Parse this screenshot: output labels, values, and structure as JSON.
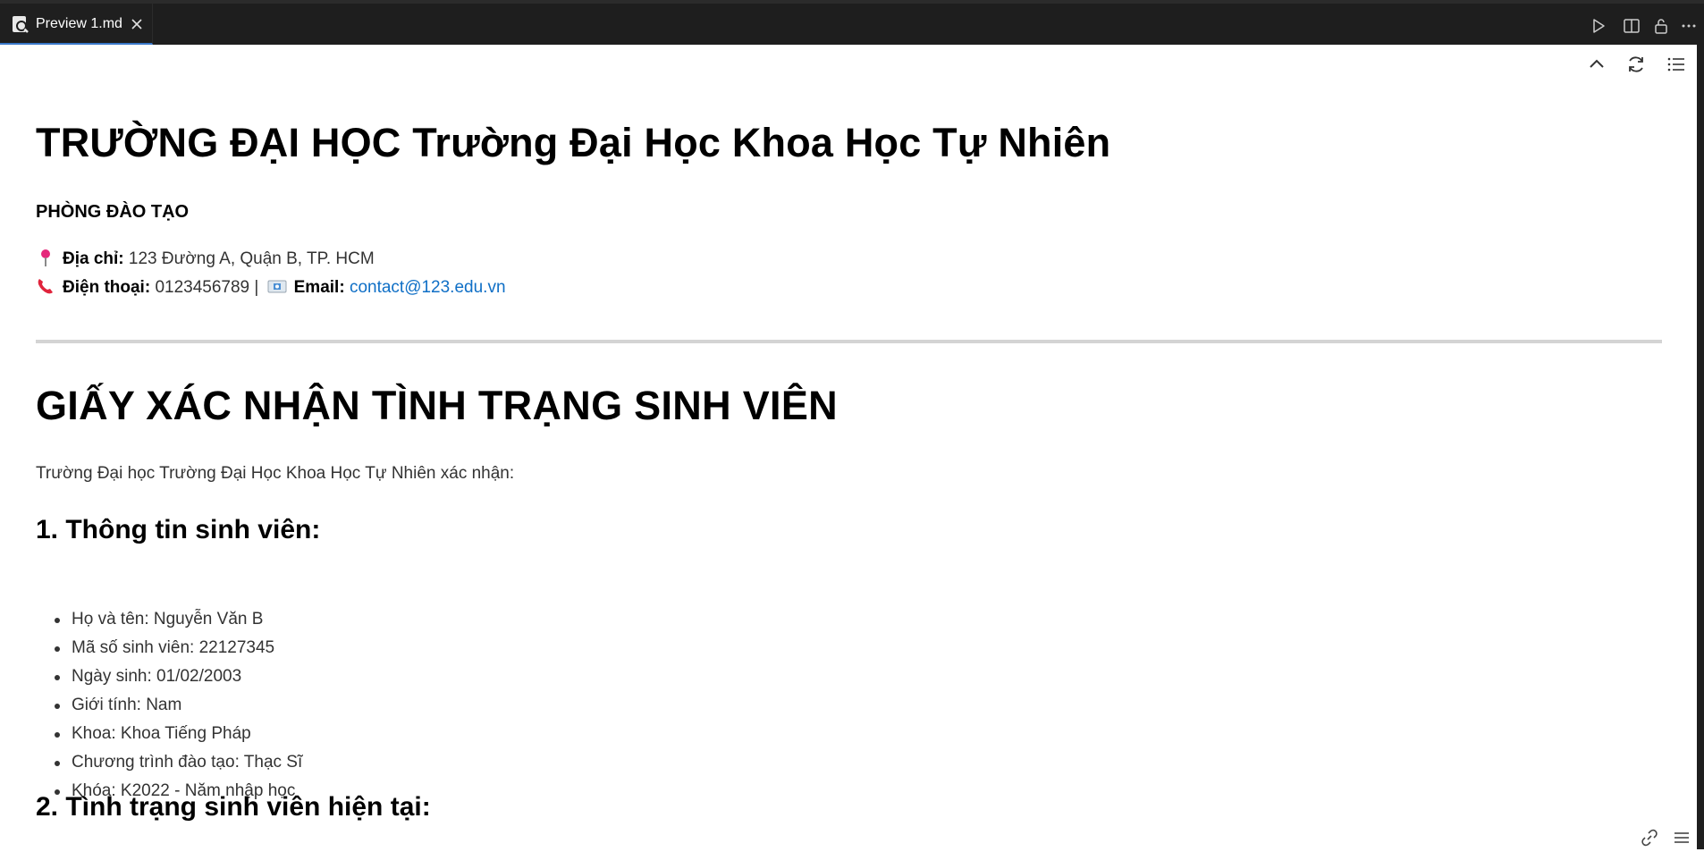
{
  "tab": {
    "label": "Preview 1.md",
    "icon": "markdown-preview-icon"
  },
  "title_actions": [
    "run-icon",
    "split-editor-icon",
    "unlock-icon",
    "more-actions-icon"
  ],
  "preview_toolbar": [
    "chevron-up-icon",
    "refresh-icon",
    "outline-list-icon"
  ],
  "document": {
    "school_heading": "TRƯỜNG ĐẠI HỌC Trường Đại Học Khoa Học Tự Nhiên",
    "department": "PHÒNG ĐÀO TẠO",
    "address_label": "Địa chỉ:",
    "address_value": "123 Đường A, Quận B, TP. HCM",
    "phone_label": "Điện thoại:",
    "phone_value": "0123456789 |",
    "email_label": "Email:",
    "email_value": "contact@123.edu.vn",
    "title": "GIẤY XÁC NHẬN TÌNH TRẠNG SINH VIÊN",
    "intro": "Trường Đại học Trường Đại Học Khoa Học Tự Nhiên xác nhận:",
    "section1": "1. Thông tin sinh viên:",
    "student_info": [
      "Họ và tên: Nguyễn Văn B",
      "Mã số sinh viên: 22127345",
      "Ngày sinh: 01/02/2003",
      "Giới tính: Nam",
      "Khoa: Khoa Tiếng Pháp",
      "Chương trình đào tạo: Thạc Sĩ",
      "Khóa: K2022 - Năm nhập học"
    ],
    "section2": "2. Tình trạng sinh viên hiện tại:"
  },
  "footer_actions": [
    "link-icon",
    "menu-icon"
  ],
  "colors": {
    "link": "#0f6fc6",
    "tab_accent": "#3a78c9",
    "titlebar": "#1e1e1e"
  }
}
